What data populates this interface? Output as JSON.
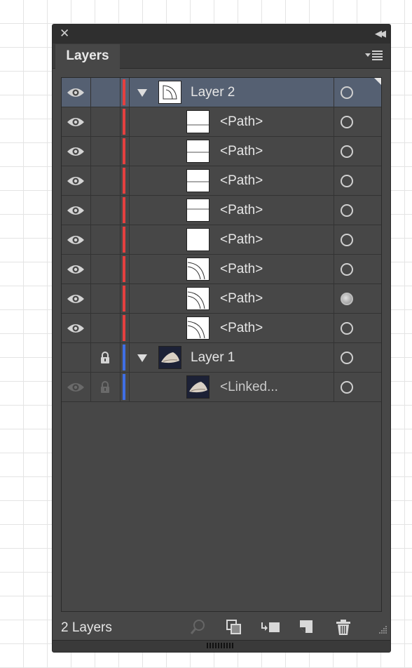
{
  "panel": {
    "tab_label": "Layers",
    "footer_count": "2 Layers",
    "colors": {
      "layer2": "#e5403f",
      "layer1": "#3f6fe5",
      "selection": "#556072"
    }
  },
  "layers": [
    {
      "name": "Layer 2",
      "level": "layer",
      "visible": true,
      "locked": false,
      "color": "red",
      "thumb": "arc-corner",
      "expanded": true,
      "selected": true,
      "target": "ring"
    },
    {
      "name": "<Path>",
      "level": "sublayer",
      "visible": true,
      "locked": false,
      "color": "red",
      "thumb": "hline-low",
      "target": "ring"
    },
    {
      "name": "<Path>",
      "level": "sublayer",
      "visible": true,
      "locked": false,
      "color": "red",
      "thumb": "hline-mid",
      "target": "ring"
    },
    {
      "name": "<Path>",
      "level": "sublayer",
      "visible": true,
      "locked": false,
      "color": "red",
      "thumb": "hline-mid",
      "target": "ring"
    },
    {
      "name": "<Path>",
      "level": "sublayer",
      "visible": true,
      "locked": false,
      "color": "red",
      "thumb": "hline-high",
      "target": "ring"
    },
    {
      "name": "<Path>",
      "level": "sublayer",
      "visible": true,
      "locked": false,
      "color": "red",
      "thumb": "blank",
      "target": "ring"
    },
    {
      "name": "<Path>",
      "level": "sublayer",
      "visible": true,
      "locked": false,
      "color": "red",
      "thumb": "arc",
      "target": "ring"
    },
    {
      "name": "<Path>",
      "level": "sublayer",
      "visible": true,
      "locked": false,
      "color": "red",
      "thumb": "arc",
      "target": "filled"
    },
    {
      "name": "<Path>",
      "level": "sublayer",
      "visible": true,
      "locked": false,
      "color": "red",
      "thumb": "arc",
      "target": "ring"
    },
    {
      "name": "Layer 1",
      "level": "layer",
      "visible": false,
      "locked": true,
      "color": "blue",
      "thumb": "photo",
      "expanded": true,
      "target": "ring"
    },
    {
      "name": "<Linked...",
      "level": "sublayer",
      "visible": "dim",
      "locked": "dim",
      "color": "blue",
      "thumb": "photo",
      "target": "ring"
    }
  ],
  "icons": {
    "close": "close-icon",
    "collapse": "collapse-icon",
    "menu": "panel-menu-icon",
    "footer": [
      "locate-object-icon",
      "make-clipping-mask-icon",
      "create-sublayer-icon",
      "create-new-layer-icon",
      "delete-icon"
    ]
  }
}
